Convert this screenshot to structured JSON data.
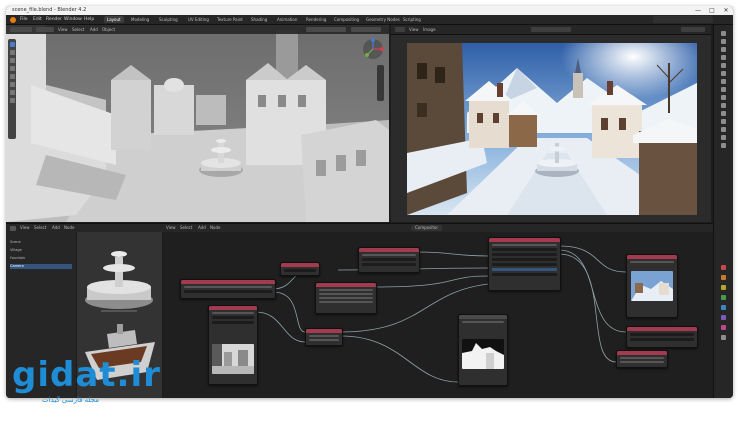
{
  "titlebar": {
    "title": "scene_file.blend - Blender 4.2",
    "controls": {
      "minimize": "—",
      "maximize": "□",
      "close": "✕"
    }
  },
  "menubar": {
    "items": [
      "File",
      "Edit",
      "Render",
      "Window",
      "Help"
    ],
    "workspace_tabs": [
      "Layout",
      "Modeling",
      "Sculpting",
      "UV Editing",
      "Texture Paint",
      "Shading",
      "Animation",
      "Rendering",
      "Compositing",
      "Geometry Nodes",
      "Scripting"
    ],
    "active_tab_index": 0
  },
  "viewport": {
    "header_menus": [
      "View",
      "Select",
      "Add",
      "Object"
    ]
  },
  "image_editor": {
    "header_menus": [
      "View",
      "Image"
    ]
  },
  "node_editor": {
    "header_menus": [
      "View",
      "Select",
      "Add",
      "Node"
    ],
    "tree_label": "Compositor"
  },
  "outliner": {
    "rows": [
      "Scene",
      "Village",
      "Fountain",
      "Camera"
    ]
  },
  "watermark": {
    "brand": "gidat.ir",
    "subtitle": "مجله فارسی گیدات"
  },
  "colors": {
    "node_header": "#a33a50",
    "accent_blue": "#4a7bd1",
    "link_cyan": "#6fb7c2"
  }
}
